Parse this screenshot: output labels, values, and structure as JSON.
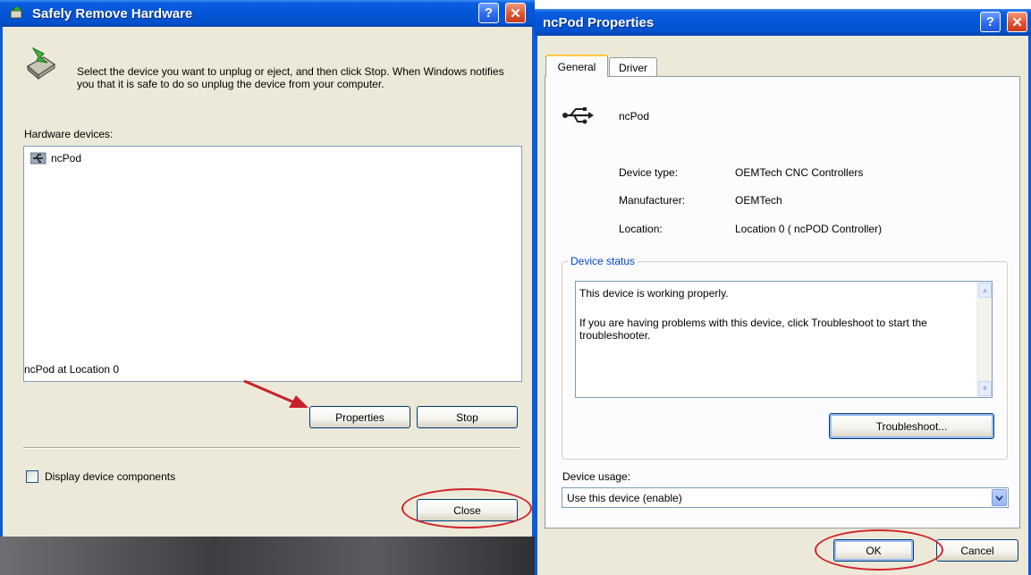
{
  "safely_remove": {
    "title": "Safely Remove Hardware",
    "help_glyph": "?",
    "close_glyph": "✕",
    "description": "Select the device you want to unplug or eject, and then click Stop. When Windows notifies you that it is safe to do so unplug the device from your computer.",
    "devices_label": "Hardware devices:",
    "devices": [
      {
        "name": "ncPod",
        "icon": "usb-device-icon"
      }
    ],
    "selected_location": "ncPod at Location 0",
    "properties_button": "Properties",
    "stop_button": "Stop",
    "display_components_label": "Display device components",
    "display_components_checked": false,
    "close_button": "Close"
  },
  "properties": {
    "title": "ncPod Properties",
    "help_glyph": "?",
    "close_glyph": "✕",
    "tabs": [
      {
        "label": "General",
        "active": true
      },
      {
        "label": "Driver",
        "active": false
      }
    ],
    "device_name": "ncPod",
    "info": [
      {
        "label": "Device type:",
        "value": "OEMTech CNC Controllers"
      },
      {
        "label": "Manufacturer:",
        "value": "OEMTech"
      },
      {
        "label": "Location:",
        "value": "Location 0 ( ncPOD Controller)"
      }
    ],
    "status_group_label": "Device status",
    "status_line1": "This device is working properly.",
    "status_line2": "If you are having problems with this device, click Troubleshoot to start the troubleshooter.",
    "troubleshoot_button": "Troubleshoot...",
    "usage_label": "Device usage:",
    "usage_value": "Use this device (enable)",
    "ok_button": "OK",
    "cancel_button": "Cancel"
  },
  "annotation_color": "#d0232b"
}
